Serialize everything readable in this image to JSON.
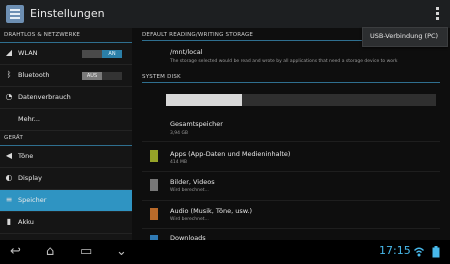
{
  "app": {
    "title": "Einstellungen"
  },
  "left": {
    "section_wireless": "DRAHTLOS & NETZWERKE",
    "section_device": "GERÄT",
    "items": {
      "wlan": {
        "label": "WLAN",
        "toggle_on": "AN"
      },
      "bluetooth": {
        "label": "Bluetooth",
        "toggle_off": "AUS"
      },
      "data": {
        "label": "Datenverbrauch"
      },
      "more": {
        "label": "Mehr..."
      },
      "tones": {
        "label": "Töne"
      },
      "display": {
        "label": "Display"
      },
      "storage": {
        "label": "Speicher"
      },
      "battery": {
        "label": "Akku"
      }
    }
  },
  "right": {
    "section_default": "DEFAULT READING/WRITING STORAGE",
    "default_path": "/mnt/local",
    "default_desc": "The storage selected would be read and wrote by all applications that need a storage device to work",
    "section_system": "SYSTEM DISK",
    "storage_used_fraction": 0.28,
    "rows": [
      {
        "title": "Gesamtspeicher",
        "sub": "3,94 GB"
      },
      {
        "title": "Apps (App-Daten und Medieninhalte)",
        "sub": "414 MB",
        "color": "#95a328"
      },
      {
        "title": "Bilder, Videos",
        "sub": "Wird berechnet...",
        "color": "#777777"
      },
      {
        "title": "Audio (Musik, Töne, usw.)",
        "sub": "Wird berechnet...",
        "color": "#b96a2a"
      },
      {
        "title": "Downloads",
        "color": "#2f79b3"
      }
    ]
  },
  "popup": {
    "label": "USB-Verbindung (PC)"
  },
  "status": {
    "time": "17:15"
  },
  "colors": {
    "accent": "#2f94c2",
    "clock": "#48b8ea"
  }
}
